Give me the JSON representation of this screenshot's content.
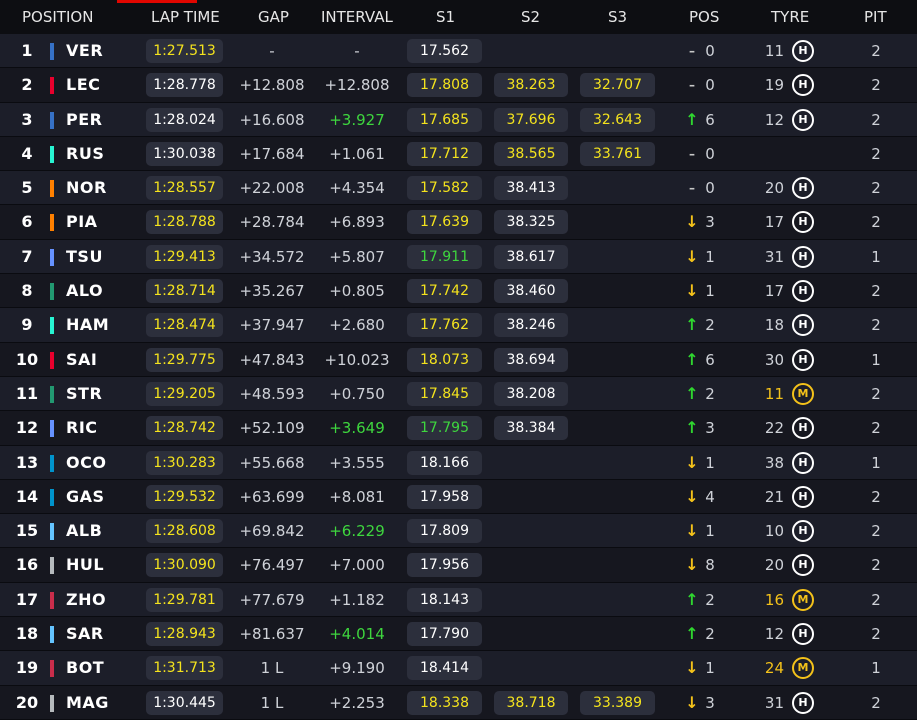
{
  "header": {
    "position": "POSITION",
    "lap_time": "LAP TIME",
    "gap": "GAP",
    "interval": "INTERVAL",
    "s1": "S1",
    "s2": "S2",
    "s3": "S3",
    "pos": "POS",
    "tyre": "TYRE",
    "pit": "PIT"
  },
  "colors": {
    "purple_yellow": "#f4e31d",
    "personal_green": "#3ed63e",
    "red_accent": "#e10600",
    "medium_tyre": "#f4c21a"
  },
  "rows": [
    {
      "pos": "1",
      "code": "VER",
      "team": "#3671c6",
      "lap": "1:27.513",
      "lapc": "y",
      "gap": "-",
      "int": "-",
      "intc": "w",
      "s1": "17.562",
      "s1c": "w",
      "s2": "",
      "s2c": "w",
      "s3": "",
      "s3c": "w",
      "dir": "same",
      "chg": "0",
      "tage": "11",
      "tcomp": "H",
      "tc": "w",
      "pit": "2"
    },
    {
      "pos": "2",
      "code": "LEC",
      "team": "#e8002d",
      "lap": "1:28.778",
      "lapc": "w",
      "gap": "+12.808",
      "int": "+12.808",
      "intc": "w",
      "s1": "17.808",
      "s1c": "y",
      "s2": "38.263",
      "s2c": "y",
      "s3": "32.707",
      "s3c": "y",
      "dir": "same",
      "chg": "0",
      "tage": "19",
      "tcomp": "H",
      "tc": "w",
      "pit": "2"
    },
    {
      "pos": "3",
      "code": "PER",
      "team": "#3671c6",
      "lap": "1:28.024",
      "lapc": "w",
      "gap": "+16.608",
      "int": "+3.927",
      "intc": "g",
      "s1": "17.685",
      "s1c": "y",
      "s2": "37.696",
      "s2c": "y",
      "s3": "32.643",
      "s3c": "y",
      "dir": "up",
      "chg": "6",
      "tage": "12",
      "tcomp": "H",
      "tc": "w",
      "pit": "2"
    },
    {
      "pos": "4",
      "code": "RUS",
      "team": "#27f4d2",
      "lap": "1:30.038",
      "lapc": "w",
      "gap": "+17.684",
      "int": "+1.061",
      "intc": "w",
      "s1": "17.712",
      "s1c": "y",
      "s2": "38.565",
      "s2c": "y",
      "s3": "33.761",
      "s3c": "y",
      "dir": "same",
      "chg": "0",
      "tage": "",
      "tcomp": "",
      "tc": "w",
      "pit": "2"
    },
    {
      "pos": "5",
      "code": "NOR",
      "team": "#ff8000",
      "lap": "1:28.557",
      "lapc": "y",
      "gap": "+22.008",
      "int": "+4.354",
      "intc": "w",
      "s1": "17.582",
      "s1c": "y",
      "s2": "38.413",
      "s2c": "w",
      "s3": "",
      "s3c": "w",
      "dir": "same",
      "chg": "0",
      "tage": "20",
      "tcomp": "H",
      "tc": "w",
      "pit": "2"
    },
    {
      "pos": "6",
      "code": "PIA",
      "team": "#ff8000",
      "lap": "1:28.788",
      "lapc": "y",
      "gap": "+28.784",
      "int": "+6.893",
      "intc": "w",
      "s1": "17.639",
      "s1c": "y",
      "s2": "38.325",
      "s2c": "w",
      "s3": "",
      "s3c": "w",
      "dir": "down",
      "chg": "3",
      "tage": "17",
      "tcomp": "H",
      "tc": "w",
      "pit": "2"
    },
    {
      "pos": "7",
      "code": "TSU",
      "team": "#6692ff",
      "lap": "1:29.413",
      "lapc": "y",
      "gap": "+34.572",
      "int": "+5.807",
      "intc": "w",
      "s1": "17.911",
      "s1c": "g",
      "s2": "38.617",
      "s2c": "w",
      "s3": "",
      "s3c": "w",
      "dir": "down",
      "chg": "1",
      "tage": "31",
      "tcomp": "H",
      "tc": "w",
      "pit": "1"
    },
    {
      "pos": "8",
      "code": "ALO",
      "team": "#229971",
      "lap": "1:28.714",
      "lapc": "y",
      "gap": "+35.267",
      "int": "+0.805",
      "intc": "w",
      "s1": "17.742",
      "s1c": "y",
      "s2": "38.460",
      "s2c": "w",
      "s3": "",
      "s3c": "w",
      "dir": "down",
      "chg": "1",
      "tage": "17",
      "tcomp": "H",
      "tc": "w",
      "pit": "2"
    },
    {
      "pos": "9",
      "code": "HAM",
      "team": "#27f4d2",
      "lap": "1:28.474",
      "lapc": "y",
      "gap": "+37.947",
      "int": "+2.680",
      "intc": "w",
      "s1": "17.762",
      "s1c": "y",
      "s2": "38.246",
      "s2c": "w",
      "s3": "",
      "s3c": "w",
      "dir": "up",
      "chg": "2",
      "tage": "18",
      "tcomp": "H",
      "tc": "w",
      "pit": "2"
    },
    {
      "pos": "10",
      "code": "SAI",
      "team": "#e8002d",
      "lap": "1:29.775",
      "lapc": "y",
      "gap": "+47.843",
      "int": "+10.023",
      "intc": "w",
      "s1": "18.073",
      "s1c": "y",
      "s2": "38.694",
      "s2c": "w",
      "s3": "",
      "s3c": "w",
      "dir": "up",
      "chg": "6",
      "tage": "30",
      "tcomp": "H",
      "tc": "w",
      "pit": "1"
    },
    {
      "pos": "11",
      "code": "STR",
      "team": "#229971",
      "lap": "1:29.205",
      "lapc": "y",
      "gap": "+48.593",
      "int": "+0.750",
      "intc": "w",
      "s1": "17.845",
      "s1c": "y",
      "s2": "38.208",
      "s2c": "w",
      "s3": "",
      "s3c": "w",
      "dir": "up",
      "chg": "2",
      "tage": "11",
      "tcomp": "M",
      "tc": "m",
      "pit": "2"
    },
    {
      "pos": "12",
      "code": "RIC",
      "team": "#6692ff",
      "lap": "1:28.742",
      "lapc": "y",
      "gap": "+52.109",
      "int": "+3.649",
      "intc": "g",
      "s1": "17.795",
      "s1c": "g",
      "s2": "38.384",
      "s2c": "w",
      "s3": "",
      "s3c": "w",
      "dir": "up",
      "chg": "3",
      "tage": "22",
      "tcomp": "H",
      "tc": "w",
      "pit": "2"
    },
    {
      "pos": "13",
      "code": "OCO",
      "team": "#0093cc",
      "lap": "1:30.283",
      "lapc": "y",
      "gap": "+55.668",
      "int": "+3.555",
      "intc": "w",
      "s1": "18.166",
      "s1c": "w",
      "s2": "",
      "s2c": "w",
      "s3": "",
      "s3c": "w",
      "dir": "down",
      "chg": "1",
      "tage": "38",
      "tcomp": "H",
      "tc": "w",
      "pit": "1"
    },
    {
      "pos": "14",
      "code": "GAS",
      "team": "#0093cc",
      "lap": "1:29.532",
      "lapc": "y",
      "gap": "+63.699",
      "int": "+8.081",
      "intc": "w",
      "s1": "17.958",
      "s1c": "w",
      "s2": "",
      "s2c": "w",
      "s3": "",
      "s3c": "w",
      "dir": "down",
      "chg": "4",
      "tage": "21",
      "tcomp": "H",
      "tc": "w",
      "pit": "2"
    },
    {
      "pos": "15",
      "code": "ALB",
      "team": "#64c4ff",
      "lap": "1:28.608",
      "lapc": "y",
      "gap": "+69.842",
      "int": "+6.229",
      "intc": "g",
      "s1": "17.809",
      "s1c": "w",
      "s2": "",
      "s2c": "w",
      "s3": "",
      "s3c": "w",
      "dir": "down",
      "chg": "1",
      "tage": "10",
      "tcomp": "H",
      "tc": "w",
      "pit": "2"
    },
    {
      "pos": "16",
      "code": "HUL",
      "team": "#b6babd",
      "lap": "1:30.090",
      "lapc": "y",
      "gap": "+76.497",
      "int": "+7.000",
      "intc": "w",
      "s1": "17.956",
      "s1c": "w",
      "s2": "",
      "s2c": "w",
      "s3": "",
      "s3c": "w",
      "dir": "down",
      "chg": "8",
      "tage": "20",
      "tcomp": "H",
      "tc": "w",
      "pit": "2"
    },
    {
      "pos": "17",
      "code": "ZHO",
      "team": "#c92d4b",
      "lap": "1:29.781",
      "lapc": "y",
      "gap": "+77.679",
      "int": "+1.182",
      "intc": "w",
      "s1": "18.143",
      "s1c": "w",
      "s2": "",
      "s2c": "w",
      "s3": "",
      "s3c": "w",
      "dir": "up",
      "chg": "2",
      "tage": "16",
      "tcomp": "M",
      "tc": "m",
      "pit": "2"
    },
    {
      "pos": "18",
      "code": "SAR",
      "team": "#64c4ff",
      "lap": "1:28.943",
      "lapc": "y",
      "gap": "+81.637",
      "int": "+4.014",
      "intc": "g",
      "s1": "17.790",
      "s1c": "w",
      "s2": "",
      "s2c": "w",
      "s3": "",
      "s3c": "w",
      "dir": "up",
      "chg": "2",
      "tage": "12",
      "tcomp": "H",
      "tc": "w",
      "pit": "2"
    },
    {
      "pos": "19",
      "code": "BOT",
      "team": "#c92d4b",
      "lap": "1:31.713",
      "lapc": "y",
      "gap": "1 L",
      "int": "+9.190",
      "intc": "w",
      "s1": "18.414",
      "s1c": "w",
      "s2": "",
      "s2c": "w",
      "s3": "",
      "s3c": "w",
      "dir": "down",
      "chg": "1",
      "tage": "24",
      "tcomp": "M",
      "tc": "m",
      "pit": "1"
    },
    {
      "pos": "20",
      "code": "MAG",
      "team": "#b6babd",
      "lap": "1:30.445",
      "lapc": "w",
      "gap": "1 L",
      "int": "+2.253",
      "intc": "w",
      "s1": "18.338",
      "s1c": "y",
      "s2": "38.718",
      "s2c": "y",
      "s3": "33.389",
      "s3c": "y",
      "dir": "down",
      "chg": "3",
      "tage": "31",
      "tcomp": "H",
      "tc": "w",
      "pit": "2"
    }
  ]
}
